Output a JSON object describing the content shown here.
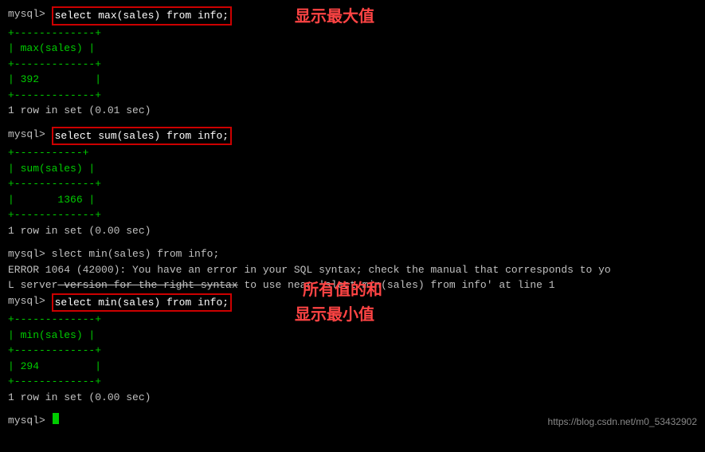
{
  "terminal": {
    "lines": [
      {
        "type": "cmd",
        "prompt": "mysql> ",
        "cmd": "select max(sales) from info;",
        "annotation": "显示最大值"
      },
      {
        "type": "table",
        "rows": [
          "+-------------+",
          "| max(sales) |",
          "+-------------+",
          "| 392         |",
          "+-------------+"
        ]
      },
      {
        "type": "result",
        "text": "1 row in set (0.01 sec)"
      },
      {
        "type": "blank"
      },
      {
        "type": "cmd",
        "prompt": "mysql> ",
        "cmd": "select sum(sales) from info;",
        "annotation": "所有值的和"
      },
      {
        "type": "table",
        "rows": [
          "+-----------+",
          "| sum(sales) |",
          "+-----------+",
          "|       1366 |",
          "+-----------+"
        ]
      },
      {
        "type": "result",
        "text": "1 row in set (0.00 sec)"
      },
      {
        "type": "blank"
      },
      {
        "type": "plain",
        "text": "mysql> slect min(sales) from info;"
      },
      {
        "type": "error1",
        "text": "ERROR 1064 (42000): You have an error in your SQL syntax; check the manual that corresponds to yo"
      },
      {
        "type": "error2",
        "text": "L server version for the right syntax to use near 'slect min(sales) from info' at line 1"
      },
      {
        "type": "cmd",
        "prompt": "mysql> ",
        "cmd": "select min(sales) from info;",
        "annotation": "显示最小值"
      },
      {
        "type": "table",
        "rows": [
          "+-------------+",
          "| min(sales) |",
          "+-------------+",
          "| 294         |",
          "+-------------+"
        ]
      },
      {
        "type": "result",
        "text": "1 row in set (0.00 sec)"
      },
      {
        "type": "blank"
      },
      {
        "type": "prompt_only",
        "prompt": "mysql> "
      }
    ],
    "watermark": "https://blog.csdn.net/m0_53432902"
  }
}
